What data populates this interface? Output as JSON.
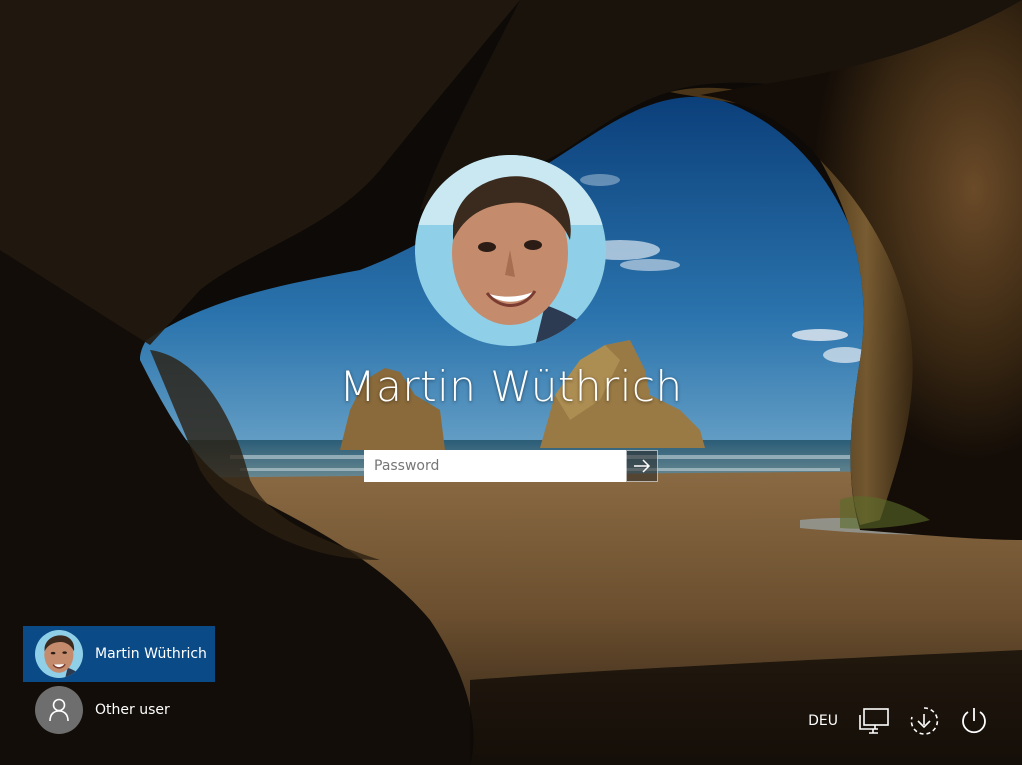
{
  "login": {
    "username": "Martin Wüthrich",
    "password_placeholder": "Password",
    "submit_icon": "arrow-right-icon"
  },
  "user_list": [
    {
      "name": "Martin Wüthrich",
      "selected": true,
      "avatar": "user-photo"
    },
    {
      "name": "Other user",
      "selected": false,
      "avatar": "person-icon"
    }
  ],
  "tray": {
    "language": "DEU",
    "network_icon": "network-icon",
    "ease_of_access_icon": "ease-of-access-icon",
    "power_icon": "power-icon"
  },
  "colors": {
    "selected_user_bg": "#0a4a86",
    "sky": "#2a6ea6",
    "cave": "#3a2a1a"
  }
}
